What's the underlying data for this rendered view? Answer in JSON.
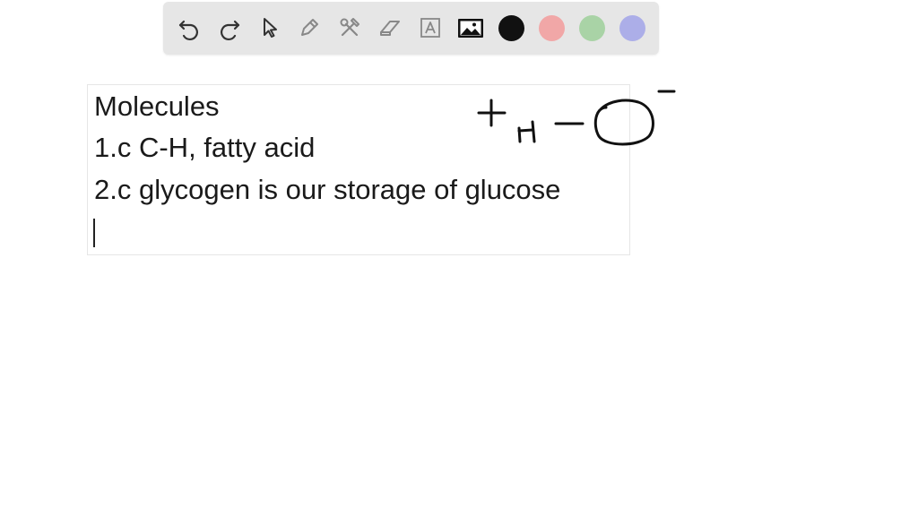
{
  "toolbar": {
    "tools": [
      {
        "name": "undo-icon",
        "label": "Undo"
      },
      {
        "name": "redo-icon",
        "label": "Redo"
      },
      {
        "name": "select-pointer-icon",
        "label": "Select"
      },
      {
        "name": "pen-icon",
        "label": "Pen"
      },
      {
        "name": "tools-icon",
        "label": "Tools"
      },
      {
        "name": "eraser-icon",
        "label": "Eraser"
      },
      {
        "name": "text-icon",
        "label": "Text"
      },
      {
        "name": "image-icon",
        "label": "Image"
      }
    ],
    "colors": [
      {
        "name": "color-black",
        "hex": "#111111",
        "selected": true
      },
      {
        "name": "color-red",
        "hex": "#f1a7a7",
        "selected": false
      },
      {
        "name": "color-green",
        "hex": "#a9d3a6",
        "selected": false
      },
      {
        "name": "color-blue",
        "hex": "#acaee8",
        "selected": false
      }
    ]
  },
  "text_box": {
    "lines": [
      "Molecules",
      "1.c C-H, fatty acid",
      "2.c glycogen is our storage of glucose"
    ]
  },
  "ink": {
    "description_icons": [
      "plus-mark",
      "H-letter",
      "dash",
      "O-circle",
      "minus-superscript"
    ]
  }
}
